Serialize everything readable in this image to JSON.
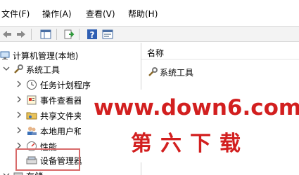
{
  "menu": {
    "file": "文件(F)",
    "action": "操作(A)",
    "view": "查看(V)",
    "help": "帮助(H)"
  },
  "toolbar": {
    "icons": [
      "back-arrow-icon",
      "forward-arrow-icon",
      "show-hide-tree-icon",
      "export-list-icon",
      "help-icon",
      "properties-icon"
    ]
  },
  "tree": {
    "root": "计算机管理(本地)",
    "system_tools": "系统工具",
    "task_scheduler": "任务计划程序",
    "event_viewer": "事件查看器",
    "shared_folders": "共享文件夹",
    "local_users": "本地用户和组",
    "performance": "性能",
    "device_manager": "设备管理器",
    "storage": "存储"
  },
  "right_pane": {
    "column_name": "名称",
    "items": [
      "系统工具"
    ]
  },
  "watermark": {
    "url": "www.down6.com",
    "cn": "第六下载"
  },
  "colors": {
    "watermark": "#d21f1f",
    "highlight_border": "#d86a6a"
  }
}
